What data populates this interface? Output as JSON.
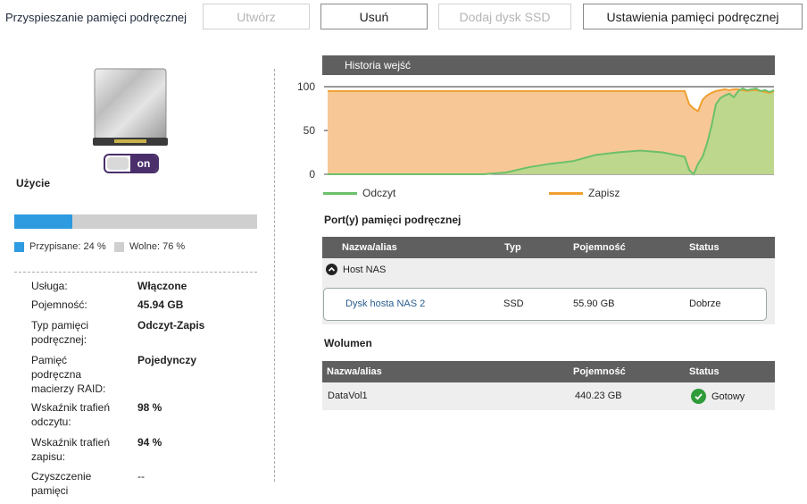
{
  "toolbar": {
    "title": "Przyspieszanie pamięci podręcznej",
    "create_label": "Utwórz",
    "delete_label": "Usuń",
    "add_ssd_label": "Dodaj dysk SSD",
    "settings_label": "Ustawienia pamięci podręcznej"
  },
  "left": {
    "toggle_label": "on",
    "usage_title": "Użycie",
    "usage": {
      "assigned_fraction": 0.24,
      "assigned_label": "Przypisane: 24 %",
      "free_label": "Wolne: 76 %",
      "assigned_color": "#2e9ae0",
      "free_color": "#cfcfcf"
    },
    "properties": [
      {
        "label": "Usługa:",
        "value": "Włączone"
      },
      {
        "label": "Pojemność:",
        "value": "45.94 GB"
      },
      {
        "label": "Typ pamięci podręcznej:",
        "value": "Odczyt-Zapis"
      },
      {
        "label": "Pamięć podręczna macierzy RAID:",
        "value": "Pojedynczy"
      },
      {
        "label": "Wskaźnik trafień odczytu:",
        "value": "98 %"
      },
      {
        "label": "Wskaźnik trafień zapisu:",
        "value": "94 %"
      },
      {
        "label": "Czyszczenie pamięci",
        "value": "--"
      }
    ]
  },
  "history": {
    "title": "Historia wejść",
    "legend": {
      "read": "Odczyt",
      "write": "Zapisz"
    },
    "colors": {
      "read": "#6cc06a",
      "write": "#f0a030"
    }
  },
  "chart_data": {
    "type": "area",
    "title": "Historia wejść",
    "ylim": [
      0,
      100
    ],
    "yticks": [
      0,
      50,
      100
    ],
    "grid": true,
    "legend_position": "bottom",
    "x": [
      0,
      5,
      10,
      15,
      20,
      25,
      30,
      35,
      40,
      45,
      50,
      55,
      60,
      65,
      70,
      75,
      80,
      81,
      82,
      83,
      84,
      85,
      86,
      87,
      88,
      89,
      90,
      91,
      92,
      93,
      94,
      95,
      96,
      97,
      98,
      99,
      100
    ],
    "series": [
      {
        "name": "Odczyt",
        "values": [
          0,
          0,
          0,
          0,
          0,
          0,
          0,
          0,
          2,
          8,
          12,
          15,
          22,
          25,
          27,
          25,
          20,
          5,
          0,
          12,
          20,
          35,
          55,
          80,
          87,
          90,
          92,
          88,
          95,
          98,
          96,
          97,
          98,
          95,
          96,
          94,
          96
        ]
      },
      {
        "name": "Zapisz",
        "values": [
          95,
          95,
          95,
          95,
          95,
          95,
          95,
          95,
          95,
          95,
          95,
          95,
          95,
          95,
          95,
          95,
          95,
          80,
          75,
          72,
          85,
          90,
          93,
          95,
          96,
          97,
          96,
          97,
          97,
          96,
          95,
          96,
          96,
          95,
          94,
          93,
          95
        ]
      }
    ]
  },
  "cache_ports": {
    "title": "Port(y) pamięci podręcznej",
    "columns": [
      "Nazwa/alias",
      "Typ",
      "Pojemność",
      "Status"
    ],
    "group_label": "Host NAS",
    "rows": [
      {
        "name": "Dysk hosta NAS 2",
        "type": "SSD",
        "capacity": "55.90 GB",
        "status": "Dobrze"
      }
    ]
  },
  "volumes": {
    "title": "Wolumen",
    "columns": [
      "Nazwa/alias",
      "Pojemność",
      "Status"
    ],
    "rows": [
      {
        "name": "DataVol1",
        "capacity": "440.23 GB",
        "status": "Gotowy",
        "status_color": "#2f9b3a"
      }
    ]
  }
}
